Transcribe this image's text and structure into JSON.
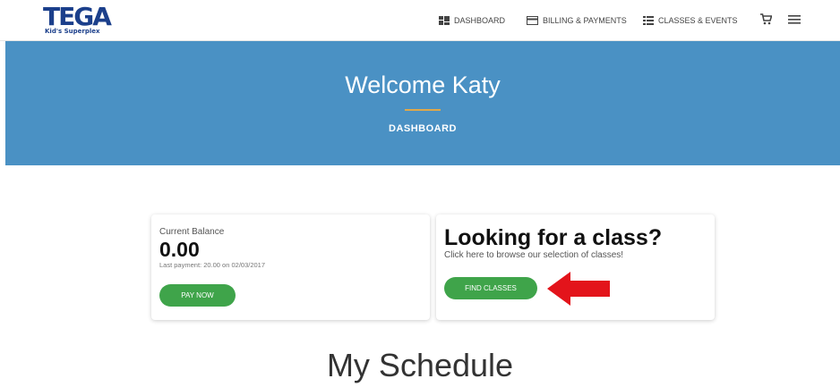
{
  "logo": {
    "main": "TEGA",
    "sub": "Kid's Superplex"
  },
  "nav": {
    "dashboard": "DASHBOARD",
    "billing": "BILLING & PAYMENTS",
    "classes": "CLASSES & EVENTS",
    "cart_icon": "cart-icon",
    "menu_icon": "hamburger-menu-icon"
  },
  "hero": {
    "title": "Welcome Katy",
    "subtitle": "DASHBOARD",
    "background": "#4a91c4",
    "divider_color": "#e0a84a"
  },
  "balance_card": {
    "label": "Current Balance",
    "amount": "0.00",
    "last_payment": "Last payment: 20.00 on 02/03/2017",
    "button": "PAY NOW"
  },
  "class_card": {
    "title": "Looking for a class?",
    "subtitle": "Click here to browse our selection of classes!",
    "button": "FIND CLASSES"
  },
  "schedule": {
    "title": "My Schedule"
  },
  "colors": {
    "button_green": "#3fa44a",
    "arrow_red": "#e3141b"
  }
}
